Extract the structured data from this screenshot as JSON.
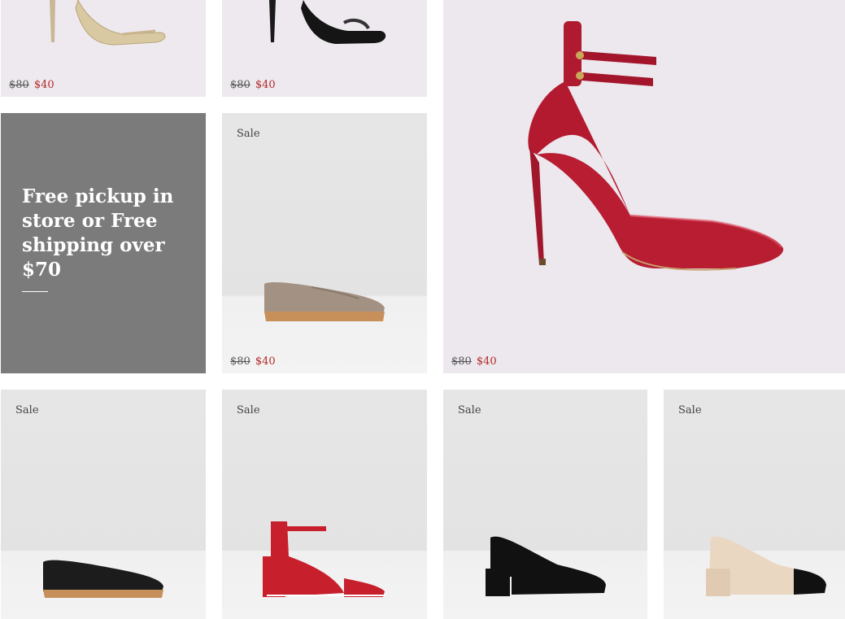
{
  "products": [
    {
      "id": "p1",
      "original_price": "$80",
      "sale_price": "$40"
    },
    {
      "id": "p2",
      "original_price": "$80",
      "sale_price": "$40"
    },
    {
      "id": "p3",
      "badge": "Sale",
      "original_price": "$80",
      "sale_price": "$40"
    },
    {
      "id": "p4",
      "original_price": "$80",
      "sale_price": "$40"
    },
    {
      "id": "p5",
      "badge": "Sale"
    },
    {
      "id": "p6",
      "badge": "Sale"
    },
    {
      "id": "p7",
      "badge": "Sale"
    },
    {
      "id": "p8",
      "badge": "Sale"
    }
  ],
  "promo": {
    "text": "Free pickup in store or Free shipping over $70"
  },
  "colors": {
    "sale_price": "#b22a2a",
    "promo_bg": "#7b7b7b",
    "tile_bg": "#ede9ee"
  }
}
